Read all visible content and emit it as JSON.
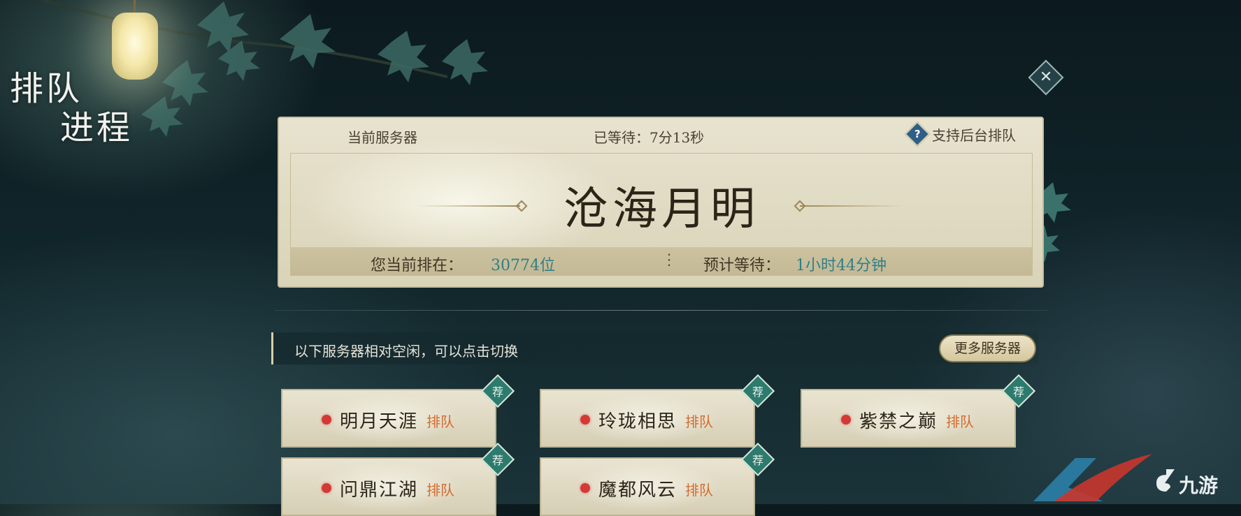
{
  "screen_title": [
    "排队",
    "进程"
  ],
  "close_icon": "close-x-icon",
  "queue_card": {
    "current_server_label": "当前服务器",
    "waited": "已等待：7分13秒",
    "help_icon": "?",
    "background_queue_label": "支持后台排队",
    "server_name": "沧海月明",
    "position_label": "您当前排在：",
    "position_value": "30774位",
    "separator": "⋮",
    "eta_label": "预计等待：",
    "eta_value": "1小时44分钟"
  },
  "idle_hint": "以下服务器相对空闲，可以点击切换",
  "more_servers_label": "更多服务器",
  "recommend_badge": "荐",
  "servers": [
    {
      "name": "明月天涯",
      "status": "排队"
    },
    {
      "name": "玲珑相思",
      "status": "排队"
    },
    {
      "name": "紫禁之巅",
      "status": "排队"
    },
    {
      "name": "问鼎江湖",
      "status": "排队"
    },
    {
      "name": "魔都风云",
      "status": "排队"
    }
  ],
  "colors": {
    "status_dot": "#d33a36",
    "status_text": "#d46a2e",
    "highlight_value": "#2f7f86",
    "badge": "#2d7a6e"
  },
  "watermark": "九游"
}
